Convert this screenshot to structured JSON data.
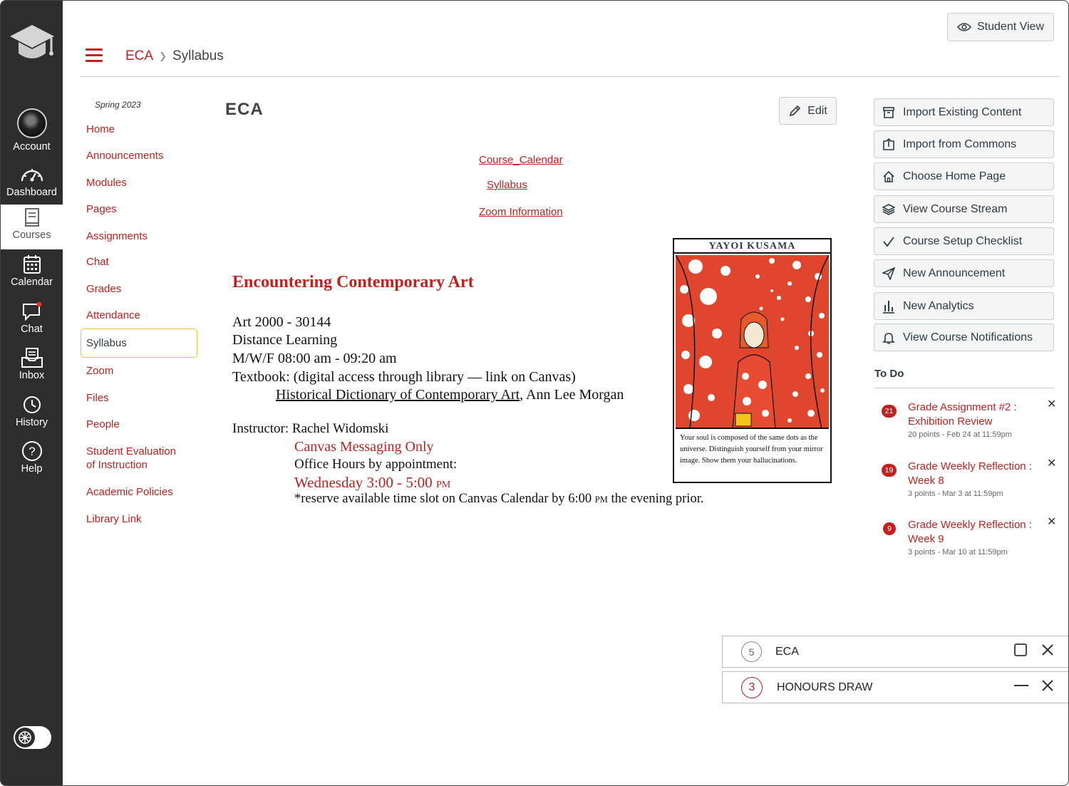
{
  "global_nav": {
    "items": [
      {
        "label": "Account",
        "icon": "account-avatar"
      },
      {
        "label": "Dashboard",
        "icon": "dashboard-icon"
      },
      {
        "label": "Courses",
        "icon": "courses-icon"
      },
      {
        "label": "Calendar",
        "icon": "calendar-icon"
      },
      {
        "label": "Chat",
        "icon": "chat-icon"
      },
      {
        "label": "Inbox",
        "icon": "inbox-icon"
      },
      {
        "label": "History",
        "icon": "history-icon"
      },
      {
        "label": "Help",
        "icon": "help-icon"
      }
    ]
  },
  "header": {
    "breadcrumb": {
      "course": "ECA",
      "page": "Syllabus"
    },
    "student_view_label": "Student View"
  },
  "course_nav": {
    "term": "Spring 2023",
    "items": [
      {
        "label": "Home"
      },
      {
        "label": "Announcements"
      },
      {
        "label": "Modules"
      },
      {
        "label": "Pages"
      },
      {
        "label": "Assignments"
      },
      {
        "label": "Chat"
      },
      {
        "label": "Grades"
      },
      {
        "label": "Attendance"
      },
      {
        "label": "Syllabus"
      },
      {
        "label": "Zoom"
      },
      {
        "label": "Files"
      },
      {
        "label": "People"
      },
      {
        "label": "Student Evaluation of Instruction"
      },
      {
        "label": "Academic Policies"
      },
      {
        "label": "Library Link"
      }
    ]
  },
  "main": {
    "title": "ECA",
    "edit_label": "Edit",
    "links": [
      "Course_Calendar",
      "Syllabus",
      "Zoom Information"
    ],
    "course_title": "Encountering Contemporary Art",
    "course_number": "Art 2000 - 30144",
    "delivery": "Distance Learning",
    "schedule": "M/W/F 08:00 am - 09:20 am",
    "textbook_intro": "Textbook: (digital access through library — link on Canvas)",
    "textbook_title": "Historical Dictionary of Contemporary Art",
    "textbook_author": ", Ann Lee Morgan",
    "instructor": "Instructor: Rachel Widomski",
    "messaging": "Canvas Messaging Only",
    "office_hours": "Office Hours by appointment:",
    "office_time": "Wednesday 3:00 - 5:00 ",
    "office_time_suffix": "PM",
    "reserve_note_a": "*reserve available time slot on Canvas Calendar by 6:00 ",
    "reserve_note_pm": "PM",
    "reserve_note_b": " the evening prior.",
    "poster": {
      "title": "YAYOI KUSAMA",
      "caption": "Your soul is composed of the same dots as the universe. Distinguish yourself from your mirror image. Show them your hallucinations."
    }
  },
  "sidebar": {
    "buttons": [
      {
        "label": "Import Existing Content",
        "icon": "archive-icon"
      },
      {
        "label": "Import from Commons",
        "icon": "import-icon"
      },
      {
        "label": "Choose Home Page",
        "icon": "home-icon"
      },
      {
        "label": "View Course Stream",
        "icon": "stream-icon"
      },
      {
        "label": "Course Setup Checklist",
        "icon": "check-icon"
      },
      {
        "label": "New Announcement",
        "icon": "send-icon"
      },
      {
        "label": "New Analytics",
        "icon": "analytics-icon"
      },
      {
        "label": "View Course Notifications",
        "icon": "bell-icon"
      }
    ],
    "todo_heading": "To Do",
    "todos": [
      {
        "badge": "21",
        "title": "Grade Assignment #2 : Exhibition Review",
        "meta": "20 points - Feb 24 at 11:59pm"
      },
      {
        "badge": "19",
        "title": "Grade Weekly Reflection : Week 8",
        "meta": "3 points - Mar 3 at 11:59pm"
      },
      {
        "badge": "9",
        "title": "Grade Weekly Reflection : Week 9",
        "meta": "3 points - Mar 10 at 11:59pm"
      }
    ]
  },
  "panels": [
    {
      "count": "5",
      "label": "ECA"
    },
    {
      "count": "3",
      "label": "HONOURS DRAW"
    }
  ],
  "colors": {
    "accent": "#c4201d",
    "nav_bg": "#2d2d2d",
    "focus": "#f0c23d"
  }
}
